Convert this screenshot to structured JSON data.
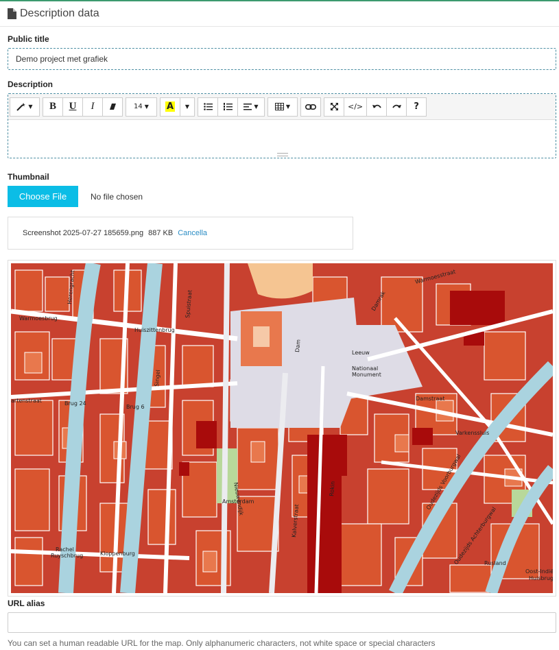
{
  "section": {
    "title": "Description data",
    "icon": "file-icon"
  },
  "public_title": {
    "label": "Public title",
    "value": "Demo project met grafiek"
  },
  "description": {
    "label": "Description",
    "toolbar": {
      "font_size": "14",
      "bold": "B",
      "underline": "U",
      "italic": "I",
      "highlight": "A",
      "code": "</>",
      "help": "?"
    }
  },
  "thumbnail": {
    "label": "Thumbnail",
    "choose_label": "Choose File",
    "status": "No file chosen",
    "file_name": "Screenshot 2025-07-27 185659.png",
    "file_size": "887 KB",
    "cancel_label": "Cancella"
  },
  "map": {
    "streets": [
      "Warmoesbrug",
      "Huiszittenbrug",
      "Herengracht",
      "Spuistraat",
      "Singel",
      "Brug 24",
      "Brug 6",
      "Damrak",
      "Dam",
      "Nieuwendijk",
      "Kalverstraat",
      "Rokin",
      "Damstraat",
      "Varkenssluis",
      "Oudezijds Voorburgwal",
      "Oudezijds Achterburgwal",
      "Kloppenburg",
      "Rusland",
      "Oost-Indië Huisbrug",
      "Warmoesstraat",
      "Rachel Ruysch brug"
    ],
    "landmarks": [
      "Leeuw",
      "Nationaal Monument",
      "Amsterdam"
    ]
  },
  "url_alias": {
    "label": "URL alias",
    "value": "",
    "help": "You can set a human readable URL for the map. Only alphanumeric characters, not white space or special characters"
  }
}
